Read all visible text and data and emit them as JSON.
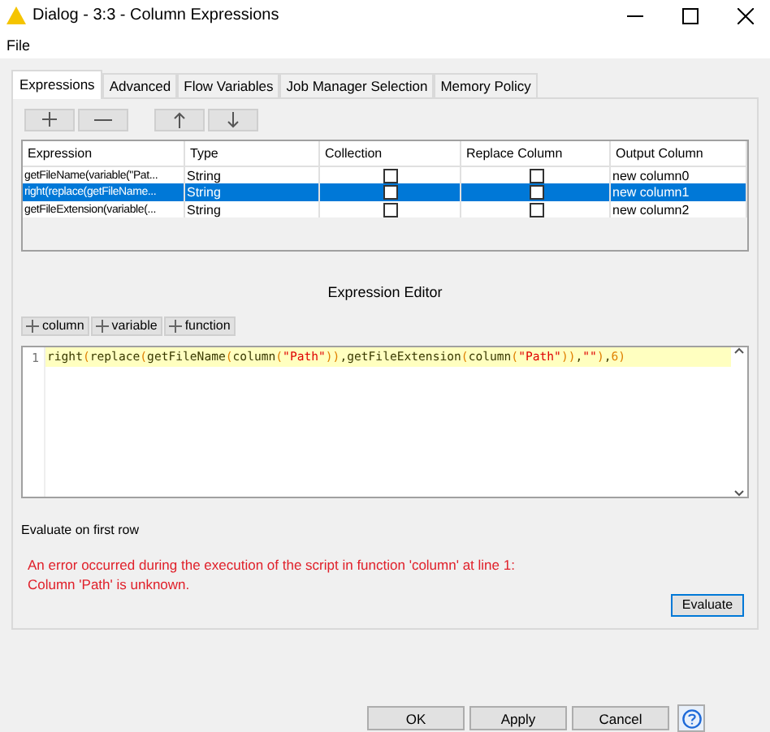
{
  "window": {
    "title": "Dialog - 3:3 - Column Expressions"
  },
  "menu": [
    "File"
  ],
  "tabs": [
    {
      "label": "Expressions",
      "selected": true
    },
    {
      "label": "Advanced",
      "selected": false
    },
    {
      "label": "Flow Variables",
      "selected": false
    },
    {
      "label": "Job Manager Selection",
      "selected": false
    },
    {
      "label": "Memory Policy",
      "selected": false
    }
  ],
  "table": {
    "columns": [
      "Expression",
      "Type",
      "Collection",
      "Replace Column",
      "Output Column"
    ],
    "rows": [
      {
        "expression": "getFileName(variable(\"Pat...",
        "type": "String",
        "collection": false,
        "replace": false,
        "output": "new column0",
        "selected": false
      },
      {
        "expression": "right(replace(getFileName...",
        "type": "String",
        "collection": false,
        "replace": false,
        "output": "new column1",
        "selected": true
      },
      {
        "expression": "getFileExtension(variable(...",
        "type": "String",
        "collection": false,
        "replace": false,
        "output": "new column2",
        "selected": false
      }
    ]
  },
  "editor": {
    "title": "Expression Editor",
    "insert_buttons": [
      "column",
      "variable",
      "function"
    ],
    "line_number": "1",
    "tokens": [
      {
        "text": "right",
        "kind": "fn"
      },
      {
        "text": "(",
        "kind": "paren"
      },
      {
        "text": "replace",
        "kind": "fn"
      },
      {
        "text": "(",
        "kind": "paren"
      },
      {
        "text": "getFileName",
        "kind": "fn"
      },
      {
        "text": "(",
        "kind": "paren"
      },
      {
        "text": "column",
        "kind": "fn"
      },
      {
        "text": "(",
        "kind": "paren"
      },
      {
        "text": "\"Path\"",
        "kind": "str"
      },
      {
        "text": "))",
        "kind": "paren"
      },
      {
        "text": ",",
        "kind": "fn"
      },
      {
        "text": "getFileExtension",
        "kind": "fn"
      },
      {
        "text": "(",
        "kind": "paren"
      },
      {
        "text": "column",
        "kind": "fn"
      },
      {
        "text": "(",
        "kind": "paren"
      },
      {
        "text": "\"Path\"",
        "kind": "str"
      },
      {
        "text": "))",
        "kind": "paren"
      },
      {
        "text": ",",
        "kind": "fn"
      },
      {
        "text": "\"\"",
        "kind": "str"
      },
      {
        "text": ")",
        "kind": "paren"
      },
      {
        "text": ",",
        "kind": "fn"
      },
      {
        "text": "6",
        "kind": "num"
      },
      {
        "text": ")",
        "kind": "paren"
      }
    ]
  },
  "evaluate_label": "Evaluate on first row",
  "error": [
    "An error occurred during the execution of the script in function 'column' at line 1:",
    "Column 'Path' is unknown."
  ],
  "evaluate_button": "Evaluate",
  "buttons": [
    "OK",
    "Apply",
    "Cancel"
  ]
}
